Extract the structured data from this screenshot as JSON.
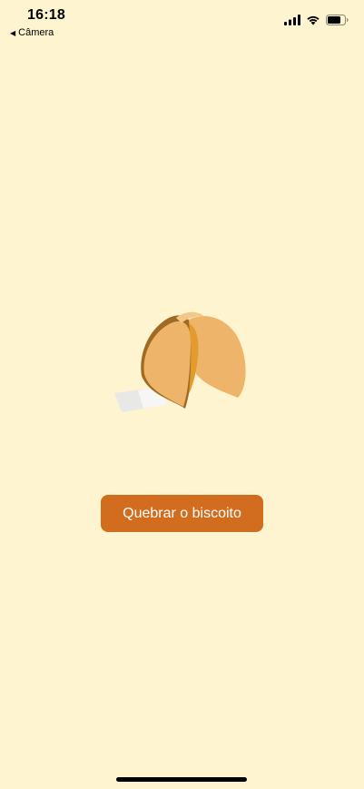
{
  "status_bar": {
    "time": "16:18",
    "back_label": "Câmera",
    "icons": [
      "cellular-signal-icon",
      "wifi-icon",
      "battery-icon"
    ]
  },
  "main": {
    "image": "fortune-cookie",
    "button_label": "Quebrar o biscoito"
  },
  "colors": {
    "background": "#FEF4CF",
    "button": "#D26D20",
    "button_text": "#FFFFFF",
    "cookie_light": "#EEB56A",
    "cookie_dark": "#E39A2E"
  }
}
